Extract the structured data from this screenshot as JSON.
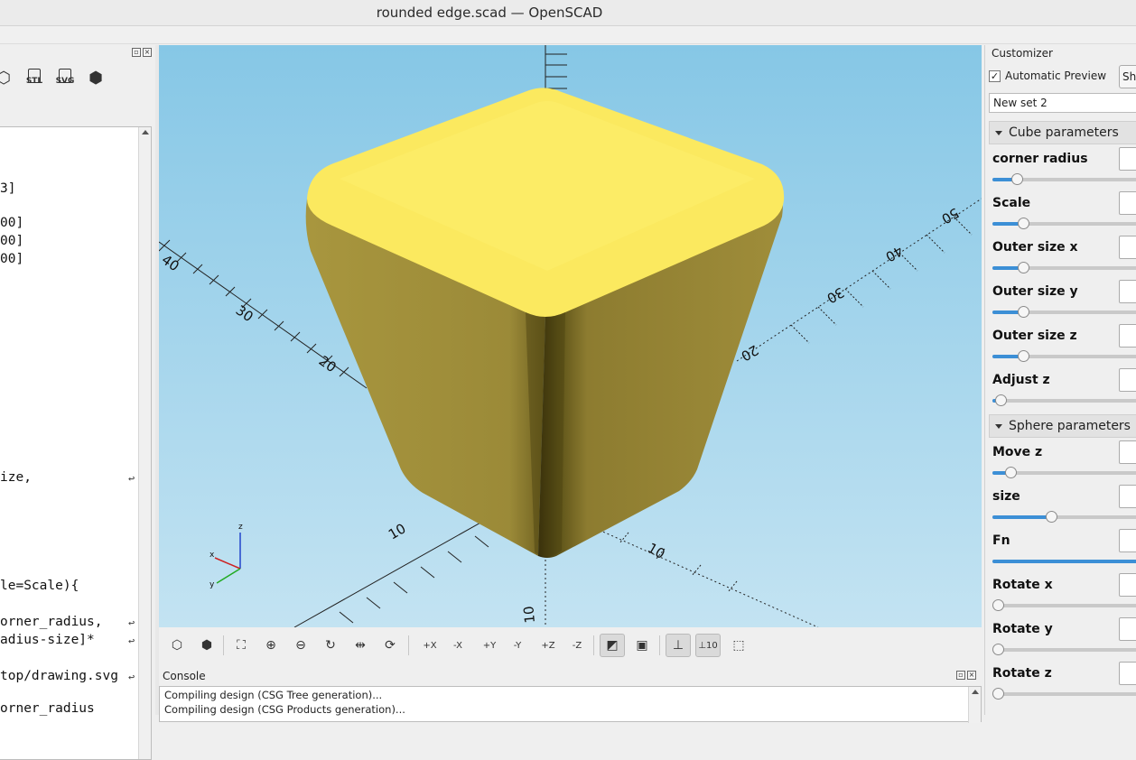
{
  "window": {
    "title": "rounded edge.scad — OpenSCAD"
  },
  "editor": {
    "toolbar": [
      {
        "name": "render-icon",
        "glyph": "⬡",
        "label": ""
      },
      {
        "name": "export-stl-icon",
        "glyph": "",
        "label": "STL"
      },
      {
        "name": "export-svg-icon",
        "glyph": "",
        "label": "SVG"
      },
      {
        "name": "send-3d-print-icon",
        "glyph": "⬢",
        "label": ""
      }
    ],
    "lines": [
      {
        "text": "3]",
        "wrap": false
      },
      {
        "text": "00]",
        "wrap": false
      },
      {
        "text": "00]",
        "wrap": false
      },
      {
        "text": "00]",
        "wrap": false
      },
      {
        "text": "ize,",
        "wrap": true
      },
      {
        "text": "le=Scale){",
        "wrap": false
      },
      {
        "text": "orner_radius,",
        "wrap": true
      },
      {
        "text": "adius-size]*",
        "wrap": true
      },
      {
        "text": "top/drawing.svg",
        "wrap": true
      },
      {
        "text": "orner_radius",
        "wrap": false
      }
    ]
  },
  "viewport": {
    "axis_labels": {
      "x_neg": [
        "40",
        "30",
        "20",
        "10"
      ],
      "y_pos": [
        "50",
        "40",
        "30",
        "20"
      ],
      "y_near": [
        "10",
        "10"
      ],
      "z": "10",
      "gizmo": [
        "z",
        "x",
        "y"
      ]
    },
    "model_color": "#f9e75a"
  },
  "view_toolbar": {
    "buttons": [
      {
        "name": "preview-button",
        "glyph": "⬡",
        "active": false
      },
      {
        "name": "render-button",
        "glyph": "⬢",
        "active": false
      },
      {
        "name": "view-all-button",
        "glyph": "⛶",
        "active": false
      },
      {
        "name": "zoom-in-button",
        "glyph": "⊕",
        "active": false
      },
      {
        "name": "zoom-out-button",
        "glyph": "⊖",
        "active": false
      },
      {
        "name": "reset-view-button",
        "glyph": "↻",
        "active": false
      },
      {
        "name": "view-center-button",
        "glyph": "⇹",
        "active": false
      },
      {
        "name": "rotate-button",
        "glyph": "⟳",
        "active": false
      },
      {
        "name": "view-right-button",
        "glyph": "+X",
        "active": false
      },
      {
        "name": "view-left-button",
        "glyph": "-X",
        "active": false
      },
      {
        "name": "view-back-button",
        "glyph": "+Y",
        "active": false
      },
      {
        "name": "view-front-button",
        "glyph": "-Y",
        "active": false
      },
      {
        "name": "view-top-button",
        "glyph": "+Z",
        "active": false
      },
      {
        "name": "view-bottom-button",
        "glyph": "-Z",
        "active": false
      },
      {
        "name": "perspective-button",
        "glyph": "◩",
        "active": true
      },
      {
        "name": "orthogonal-button",
        "glyph": "▣",
        "active": false
      },
      {
        "name": "show-axes-button",
        "glyph": "⊥",
        "active": true
      },
      {
        "name": "show-scale-button",
        "glyph": "⊥10",
        "active": true
      },
      {
        "name": "show-edges-button",
        "glyph": "⬚",
        "active": false
      }
    ]
  },
  "console": {
    "title": "Console",
    "lines": [
      "Compiling design (CSG Tree generation)...",
      "Compiling design (CSG Products generation)..."
    ]
  },
  "customizer": {
    "title": "Customizer",
    "automatic_preview_label": "Automatic Preview",
    "automatic_preview_checked": true,
    "show_button_label": "Sho",
    "preset": "New set 2",
    "groups": [
      {
        "title": "Cube parameters",
        "params": [
          {
            "label": "corner radius",
            "fraction": 0.16
          },
          {
            "label": "Scale",
            "fraction": 0.2
          },
          {
            "label": "Outer size x",
            "fraction": 0.2
          },
          {
            "label": "Outer size y",
            "fraction": 0.2
          },
          {
            "label": "Outer size z",
            "fraction": 0.2
          },
          {
            "label": "Adjust z",
            "fraction": 0.05
          }
        ]
      },
      {
        "title": "Sphere parameters",
        "params": [
          {
            "label": "Move z",
            "fraction": 0.12
          },
          {
            "label": "size",
            "fraction": 0.38
          },
          {
            "label": "Fn",
            "fraction": 0.99
          },
          {
            "label": "Rotate x",
            "fraction": 0.0
          },
          {
            "label": "Rotate y",
            "fraction": 0.0
          },
          {
            "label": "Rotate z",
            "fraction": 0.0
          }
        ]
      }
    ]
  }
}
